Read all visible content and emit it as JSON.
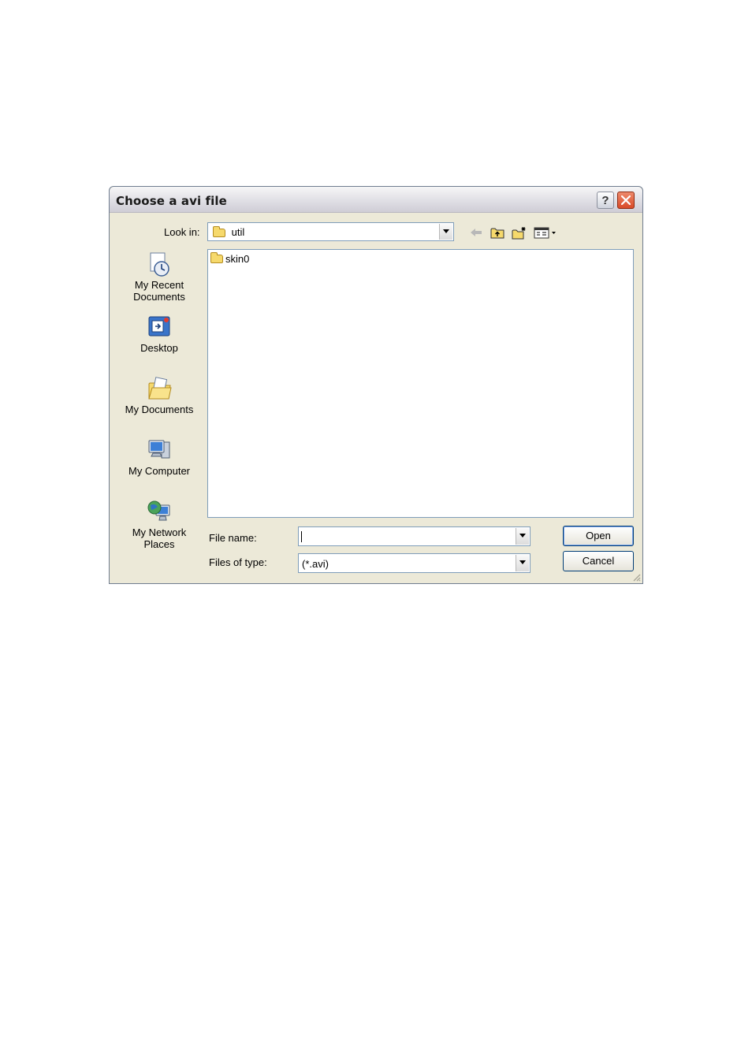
{
  "dialog": {
    "title": "Choose a avi file",
    "help_label": "?",
    "close_label": "✕"
  },
  "toolbar": {
    "look_in_label": "Look in:",
    "look_in_value": "util",
    "icons": [
      "back-arrow-icon",
      "up-folder-icon",
      "new-folder-icon",
      "view-menu-icon"
    ]
  },
  "places": [
    {
      "label": "My Recent Documents",
      "icon": "recent-documents-icon"
    },
    {
      "label": "Desktop",
      "icon": "desktop-icon"
    },
    {
      "label": "My Documents",
      "icon": "my-documents-icon"
    },
    {
      "label": "My Computer",
      "icon": "my-computer-icon"
    },
    {
      "label": "My Network Places",
      "icon": "network-places-icon"
    }
  ],
  "files": [
    {
      "name": "skin0",
      "type": "folder"
    }
  ],
  "form": {
    "file_name_label": "File name:",
    "file_name_value": "",
    "file_type_label": "Files of type:",
    "file_type_value": "(*.avi)"
  },
  "buttons": {
    "open": "Open",
    "cancel": "Cancel"
  },
  "colors": {
    "dialog_bg": "#ece9d8",
    "close_button": "#d94a28",
    "folder": "#f6d96c"
  }
}
